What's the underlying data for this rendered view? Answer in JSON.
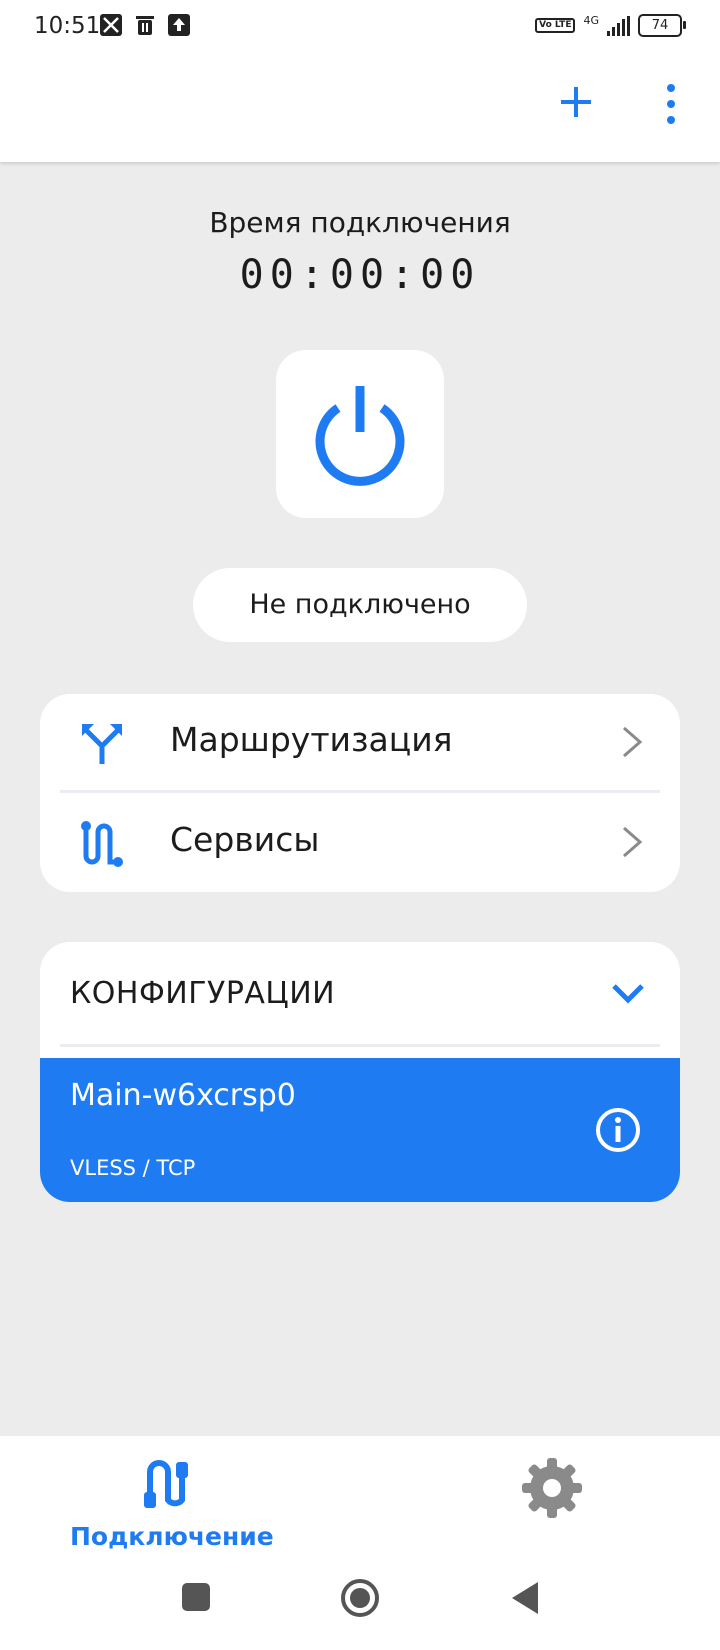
{
  "status_bar": {
    "time": "10:51",
    "network": "4G",
    "volte": "Vo LTE",
    "battery": "74"
  },
  "app_bar": {
    "add_icon": "plus-icon",
    "more_icon": "more-vert-icon"
  },
  "connection": {
    "time_label": "Время подключения",
    "timer": "00:00:00",
    "power_icon": "power-icon",
    "status": "Не подключено"
  },
  "menu": {
    "items": [
      {
        "label": "Маршрутизация",
        "icon": "routing-icon"
      },
      {
        "label": "Сервисы",
        "icon": "services-icon"
      }
    ]
  },
  "configs": {
    "title": "КОНФИГУРАЦИИ",
    "items": [
      {
        "name": "Main-w6xcrsp0",
        "protocol": "VLESS / TCP",
        "selected": true
      }
    ]
  },
  "bottom_nav": {
    "connect_label": "Подключение",
    "settings_icon": "gear-icon"
  },
  "colors": {
    "accent": "#1f7bf2",
    "background": "#ececec",
    "card": "#ffffff"
  }
}
